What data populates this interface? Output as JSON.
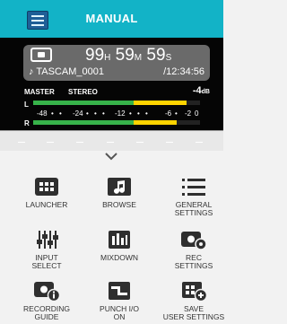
{
  "header": {
    "title": "MANUAL"
  },
  "status": {
    "hours": "99",
    "hours_unit": "H",
    "minutes": "59",
    "minutes_unit": "M",
    "seconds": "59",
    "seconds_unit": "S",
    "file_name": "TASCAM_0001",
    "remaining": "/12:34:56",
    "meter_mode": "MASTER",
    "meter_type": "STEREO",
    "peak": "-4",
    "peak_unit": "dB",
    "left_label": "L",
    "right_label": "R",
    "scale": [
      "-48",
      "-24",
      "-12",
      "-6",
      "-2",
      "0"
    ],
    "levels": {
      "left": 0.92,
      "right": 0.86
    }
  },
  "menu": {
    "items": [
      {
        "label": "LAUNCHER",
        "icon": "launcher-icon"
      },
      {
        "label": "BROWSE",
        "icon": "browse-icon"
      },
      {
        "label": "GENERAL\nSETTINGS",
        "icon": "general-settings-icon"
      },
      {
        "label": "INPUT\nSELECT",
        "icon": "input-select-icon"
      },
      {
        "label": "MIXDOWN",
        "icon": "mixdown-icon"
      },
      {
        "label": "REC\nSETTINGS",
        "icon": "rec-settings-icon"
      },
      {
        "label": "RECORDING\nGUIDE",
        "icon": "recording-guide-icon"
      },
      {
        "label": "PUNCH I/O\nON",
        "icon": "punch-io-icon"
      },
      {
        "label": "SAVE\nUSER SETTINGS",
        "icon": "save-user-settings-icon"
      }
    ]
  }
}
